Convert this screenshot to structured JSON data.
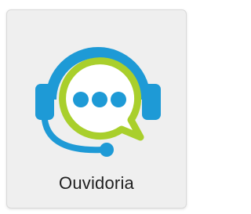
{
  "tile": {
    "label": "Ouvidoria",
    "icon": "headset-chat-icon"
  },
  "colors": {
    "headset_blue": "#1e9ad6",
    "bubble_green": "#a9cf2c",
    "dots_blue": "#1e9ad6",
    "tile_background": "#efefef",
    "label_text": "#1f1f1f"
  }
}
